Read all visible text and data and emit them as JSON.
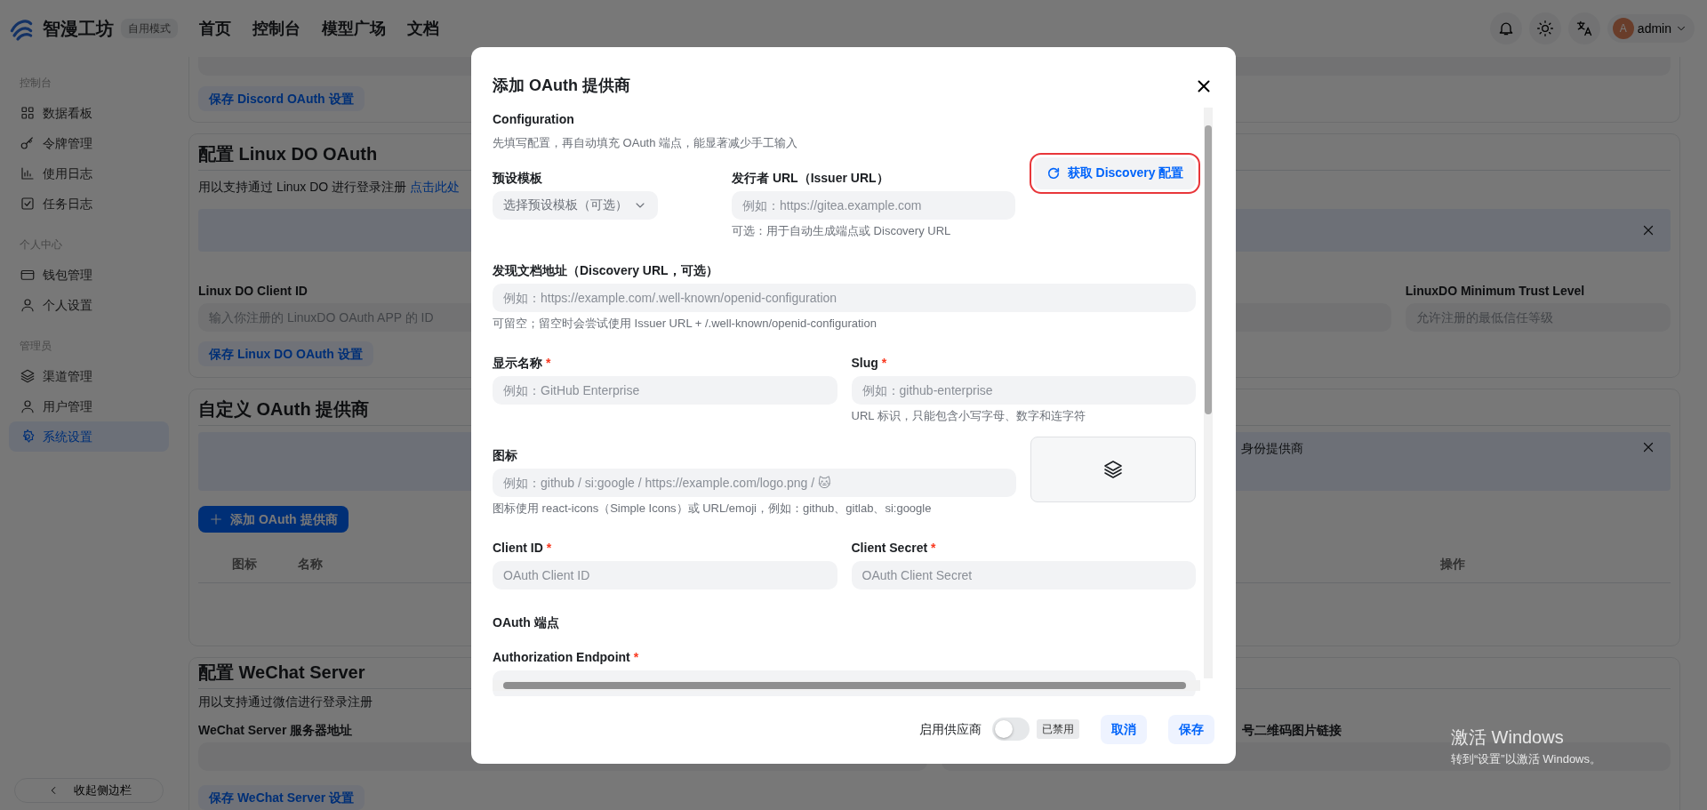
{
  "header": {
    "brand": "智漫工坊",
    "mode_badge": "自用模式",
    "nav": [
      {
        "label": "首页"
      },
      {
        "label": "控制台"
      },
      {
        "label": "模型广场"
      },
      {
        "label": "文档"
      }
    ],
    "user": {
      "avatar": "A",
      "name": "admin"
    }
  },
  "sidebar": {
    "groups": [
      {
        "title": "控制台",
        "items": [
          {
            "label": "数据看板",
            "kind": "grid",
            "selected": false
          },
          {
            "label": "令牌管理",
            "kind": "key",
            "selected": false
          },
          {
            "label": "使用日志",
            "kind": "chart",
            "selected": false
          },
          {
            "label": "任务日志",
            "kind": "check",
            "selected": false
          }
        ]
      },
      {
        "title": "个人中心",
        "items": [
          {
            "label": "钱包管理",
            "kind": "card",
            "selected": false
          },
          {
            "label": "个人设置",
            "kind": "user",
            "selected": false
          }
        ]
      },
      {
        "title": "管理员",
        "items": [
          {
            "label": "渠道管理",
            "kind": "layers",
            "selected": false
          },
          {
            "label": "用户管理",
            "kind": "user",
            "selected": false
          },
          {
            "label": "系统设置",
            "kind": "gear",
            "selected": true
          }
        ]
      }
    ],
    "collapse_button": "收起侧边栏"
  },
  "page": {
    "discord_card": {
      "save_button": "保存 Discord OAuth 设置"
    },
    "linux_do_card": {
      "title": "配置 Linux DO OAuth",
      "description": "用以支持通过 Linux DO 进行登录注册",
      "link": "点击此处",
      "client_id_label": "Linux DO Client ID",
      "client_id_placeholder": "输入你注册的 LinuxDO OAuth APP 的 ID",
      "trust_label": "LinuxDO Minimum Trust Level",
      "trust_placeholder": "允许注册的最低信任等级",
      "save_button": "保存 Linux DO OAuth 设置"
    },
    "custom_card": {
      "title": "自定义 OAuth 提供商",
      "banner_text": "身份提供商",
      "add_button": "添加 OAuth 提供商",
      "table": {
        "columns": [
          "图标",
          "名称",
          "操作"
        ]
      }
    },
    "wechat_card": {
      "title": "配置 WeChat Server",
      "description": "用以支持通过微信进行登录注册",
      "server_label": "WeChat Server 服务器地址",
      "qr_label": "号二维码图片链接",
      "save_button": "保存 WeChat Server 设置"
    }
  },
  "dialog": {
    "title": "添加 OAuth 提供商",
    "section": "Configuration",
    "section_hint": "先填写配置，再自动填充 OAuth 端点，能显著减少手工输入",
    "preset": {
      "label": "预设模板",
      "placeholder": "选择预设模板（可选）"
    },
    "issuer": {
      "label": "发行者 URL（Issuer URL）",
      "placeholder": "例如：https://gitea.example.com",
      "hint": "可选：用于自动生成端点或 Discovery URL"
    },
    "discovery_button": {
      "label": "获取 Discovery 配置",
      "highlighted": true
    },
    "discovery_url": {
      "label": "发现文档地址（Discovery URL，可选）",
      "placeholder": "例如：https://example.com/.well-known/openid-configuration",
      "hint": "可留空；留空时会尝试使用 Issuer URL + /.well-known/openid-configuration"
    },
    "display_name": {
      "label": "显示名称",
      "required_mark": "*",
      "placeholder": "例如：GitHub Enterprise"
    },
    "slug": {
      "label": "Slug",
      "required_mark": "*",
      "placeholder": "例如：github-enterprise",
      "hint": "URL 标识，只能包含小写字母、数字和连字符"
    },
    "icon": {
      "label": "图标",
      "placeholder": "例如：github / si:google / https://example.com/logo.png / 🐱",
      "hint": "图标使用 react-icons（Simple Icons）或 URL/emoji，例如：github、gitlab、si:google"
    },
    "client_id": {
      "label": "Client ID",
      "required_mark": "*",
      "placeholder": "OAuth Client ID"
    },
    "client_secret": {
      "label": "Client Secret",
      "required_mark": "*",
      "placeholder": "OAuth Client Secret"
    },
    "endpoints_heading": "OAuth 端点",
    "authorization_endpoint": {
      "label": "Authorization Endpoint",
      "required_mark": "*"
    },
    "footer": {
      "enable_label": "启用供应商",
      "enabled": false,
      "status_badge": "已禁用",
      "cancel_button": "取消",
      "save_button": "保存"
    }
  },
  "os_notice": {
    "title": "激活 Windows",
    "subtitle": "转到“设置”以激活 Windows。"
  }
}
